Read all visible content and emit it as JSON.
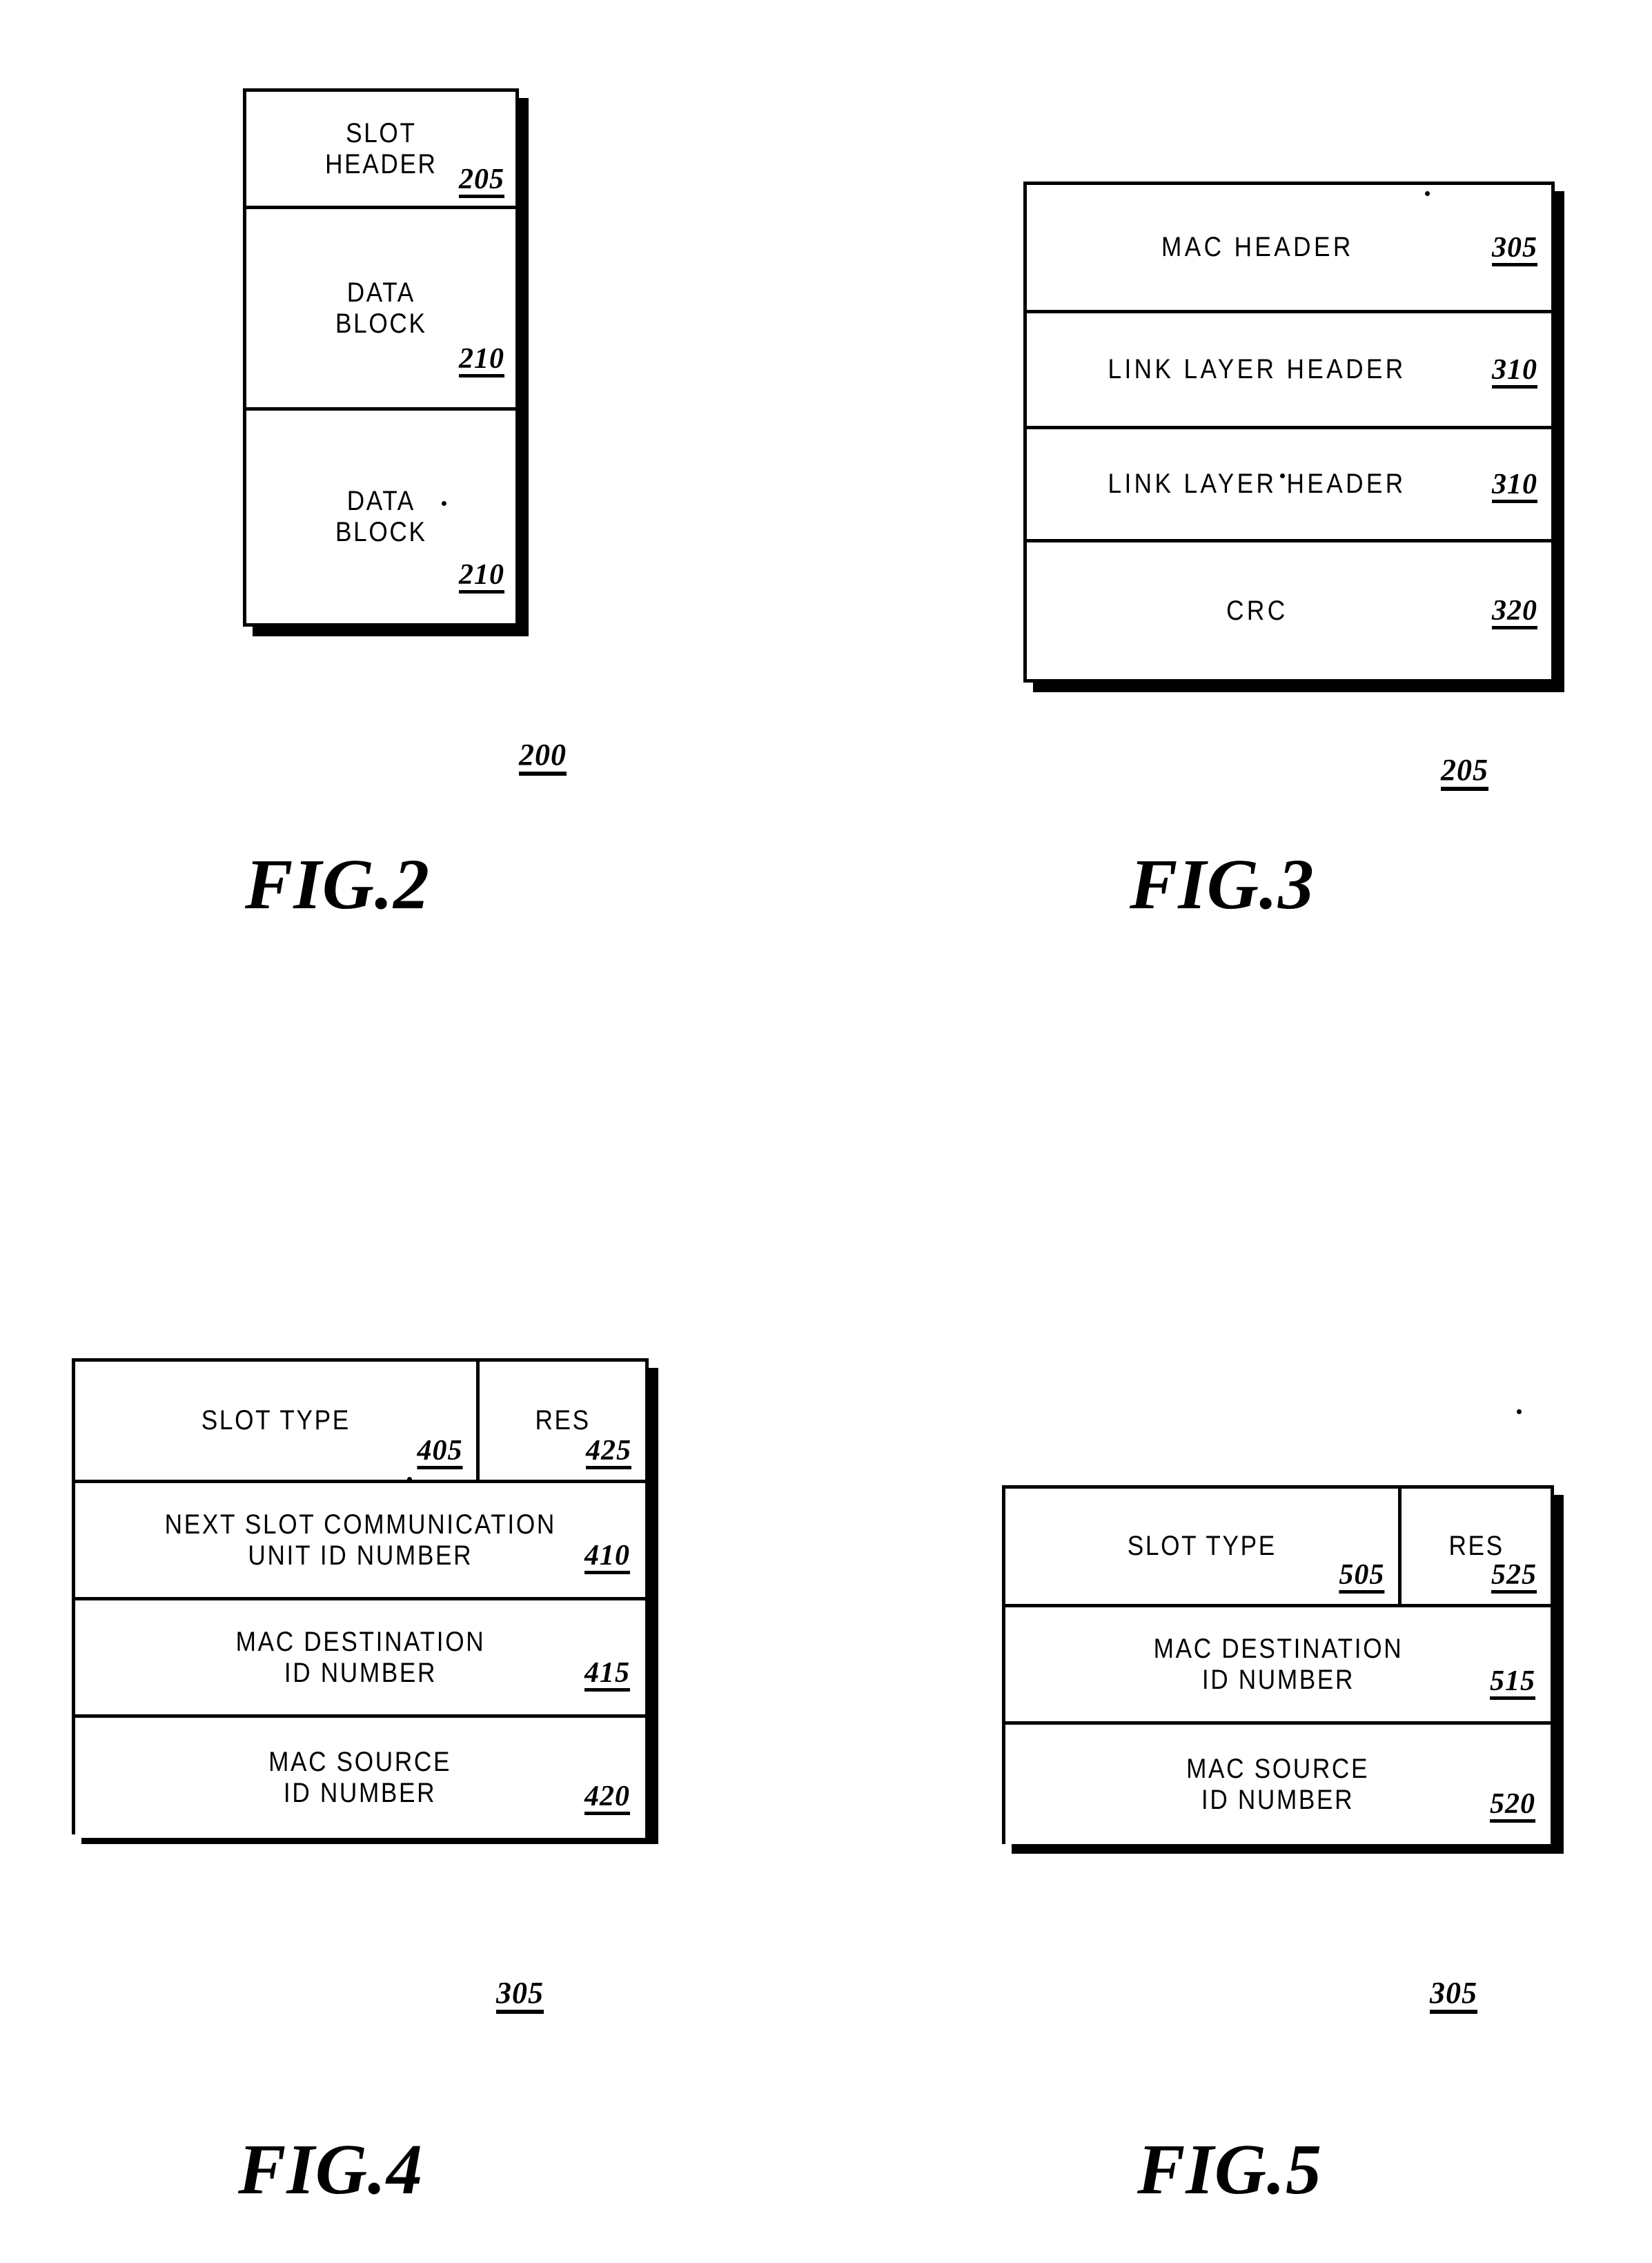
{
  "figures": [
    {
      "id": "fig2",
      "caption": "FIG.2",
      "figure_ref": "200",
      "blocks": [
        {
          "label": "SLOT\nHEADER",
          "ref": "205"
        },
        {
          "label": "DATA\nBLOCK",
          "ref": "210"
        },
        {
          "label": "DATA\nBLOCK",
          "ref": "210"
        }
      ]
    },
    {
      "id": "fig3",
      "caption": "FIG.3",
      "figure_ref": "205",
      "blocks": [
        {
          "label": "MAC HEADER",
          "ref": "305"
        },
        {
          "label": "LINK LAYER HEADER",
          "ref": "310"
        },
        {
          "label": "LINK LAYER HEADER",
          "ref": "310"
        },
        {
          "label": "CRC",
          "ref": "320"
        }
      ]
    },
    {
      "id": "fig4",
      "caption": "FIG.4",
      "figure_ref": "305",
      "blocks": [
        {
          "split": true,
          "cells": [
            {
              "label": "SLOT TYPE",
              "ref": "405"
            },
            {
              "label": "RES",
              "ref": "425"
            }
          ]
        },
        {
          "label": "NEXT SLOT COMMUNICATION\nUNIT ID NUMBER",
          "ref": "410"
        },
        {
          "label": "MAC DESTINATION\nID NUMBER",
          "ref": "415"
        },
        {
          "label": "MAC SOURCE\nID NUMBER",
          "ref": "420"
        }
      ]
    },
    {
      "id": "fig5",
      "caption": "FIG.5",
      "figure_ref": "305",
      "blocks": [
        {
          "split": true,
          "cells": [
            {
              "label": "SLOT TYPE",
              "ref": "505"
            },
            {
              "label": "RES",
              "ref": "525"
            }
          ]
        },
        {
          "label": "MAC DESTINATION\nID NUMBER",
          "ref": "515"
        },
        {
          "label": "MAC SOURCE\nID NUMBER",
          "ref": "520"
        }
      ]
    }
  ],
  "colors": {
    "ink": "#000000",
    "paper": "#ffffff"
  }
}
